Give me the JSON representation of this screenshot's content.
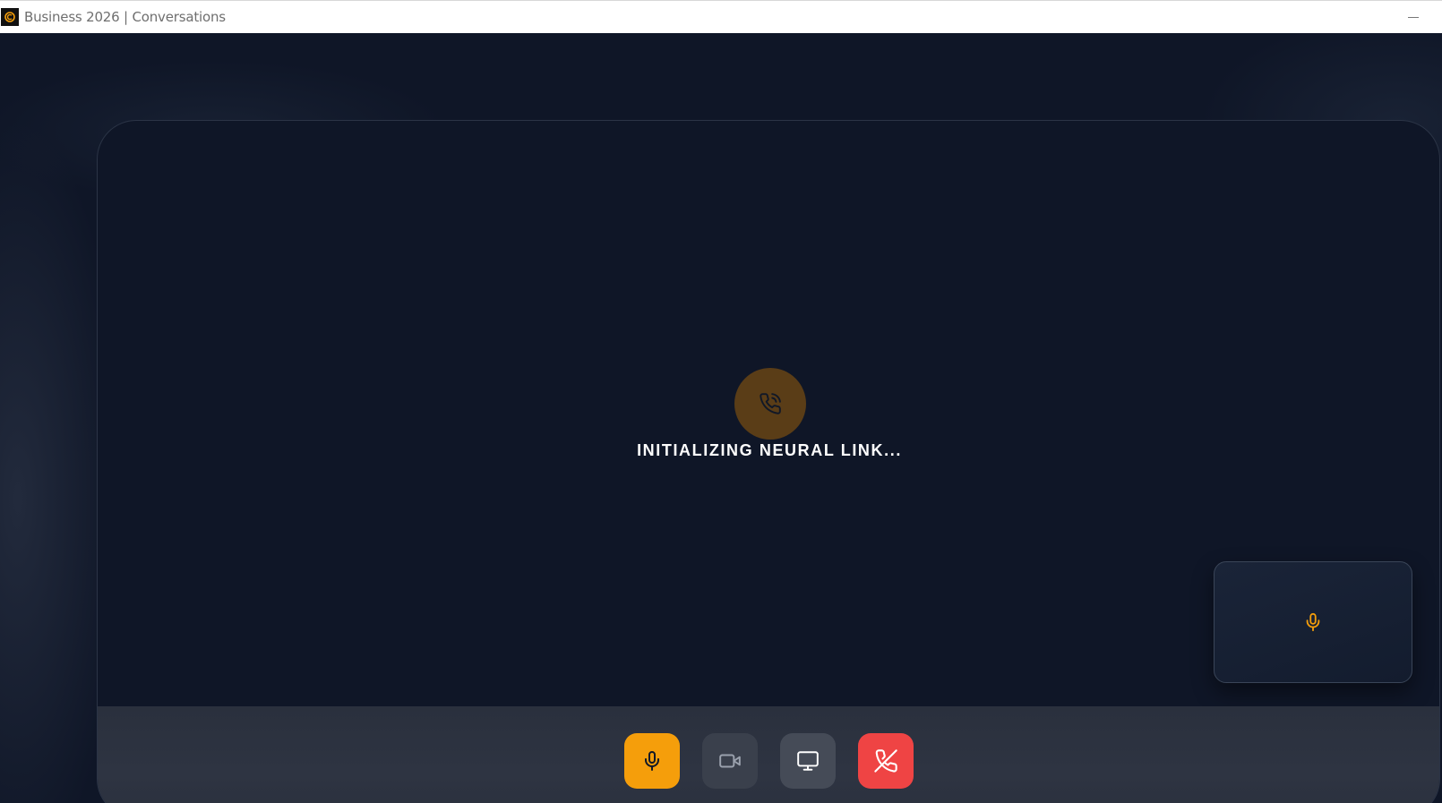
{
  "window": {
    "title": "Business 2026 | Conversations",
    "app_icon": "app-logo-icon",
    "minimize_icon": "minimize-icon"
  },
  "call": {
    "status_text": "INITIALIZING NEURAL LINK...",
    "status_icon": "phone-call-icon",
    "self_view_icon": "microphone-icon"
  },
  "controls": [
    {
      "name": "mic",
      "icon": "microphone-icon",
      "color": "#f59e0b",
      "active": true
    },
    {
      "name": "video",
      "icon": "video-camera-icon",
      "color": "#3a404c",
      "active": false
    },
    {
      "name": "screen-share",
      "icon": "monitor-icon",
      "color": "#454b57",
      "active": false
    },
    {
      "name": "end-call",
      "icon": "phone-off-icon",
      "color": "#ef4444",
      "active": false
    }
  ],
  "colors": {
    "accent": "#f59e0b",
    "danger": "#ef4444",
    "background": "#0f1627"
  }
}
